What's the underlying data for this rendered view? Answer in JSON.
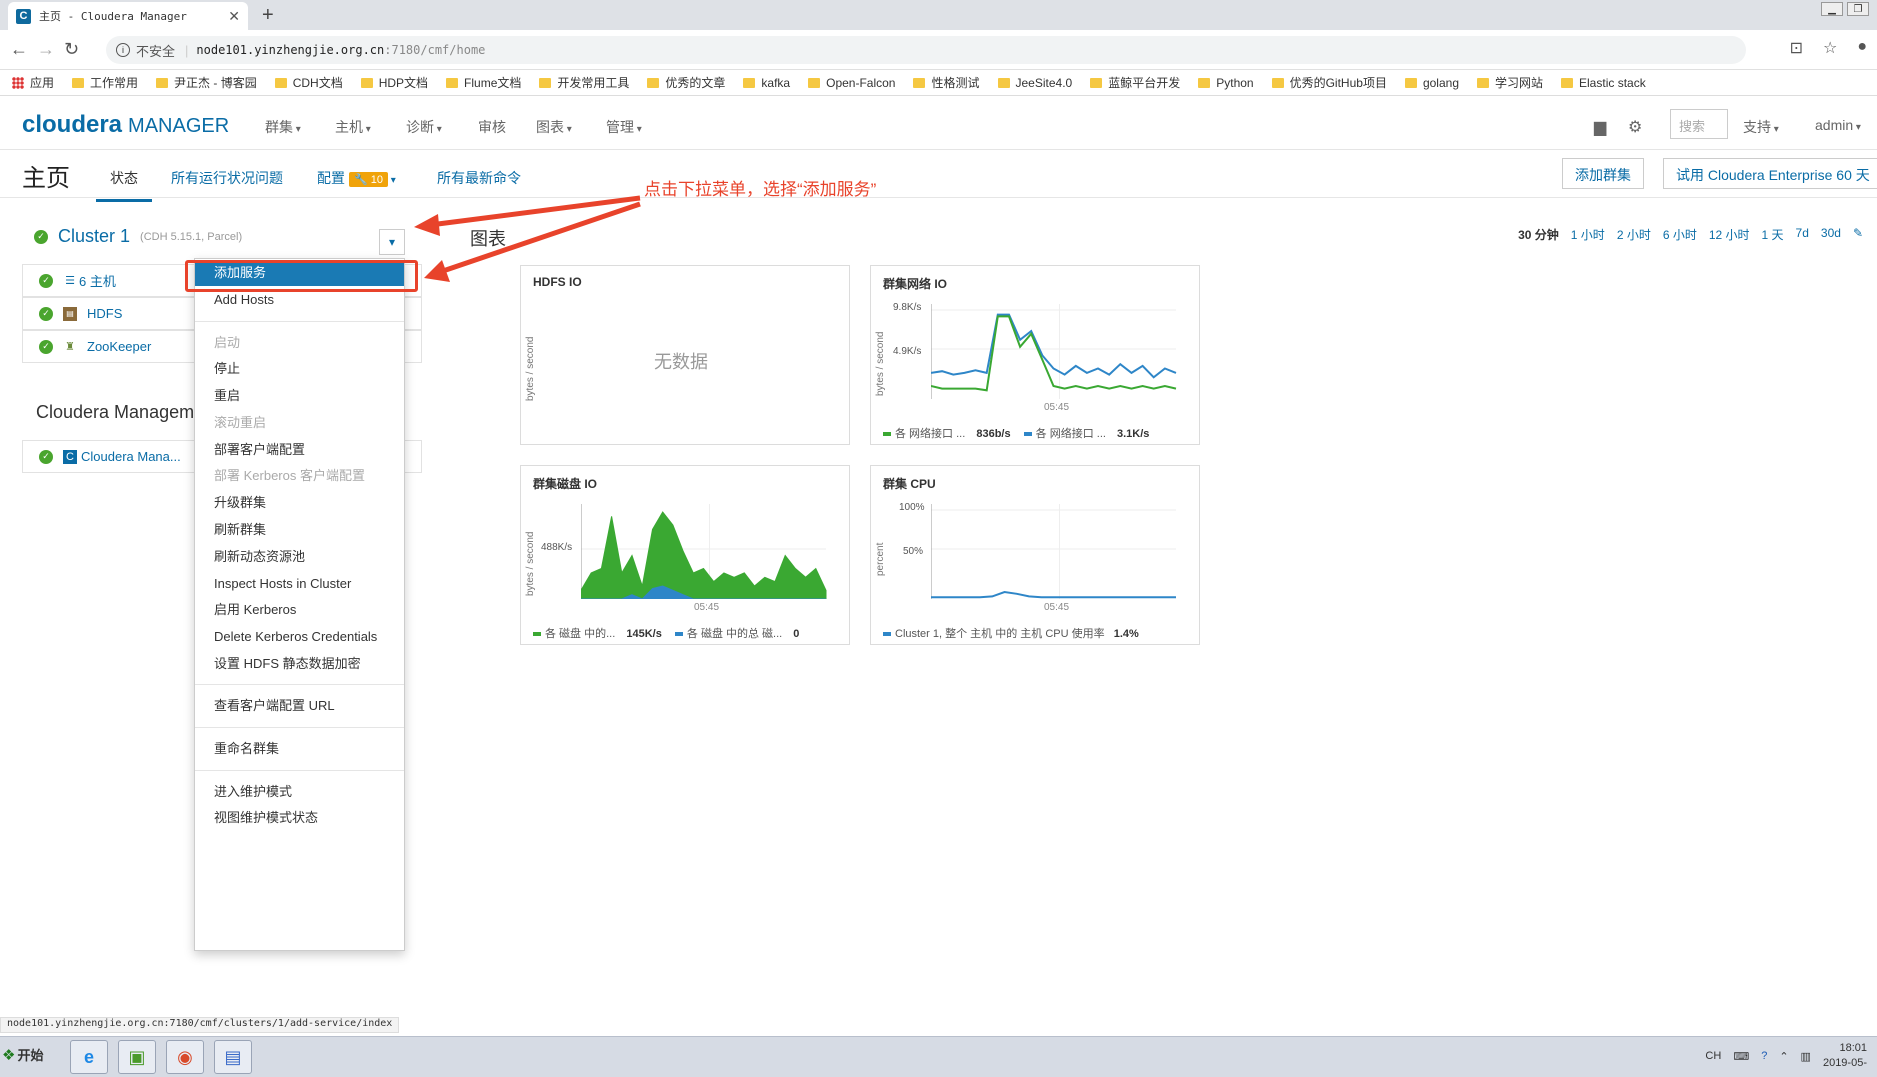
{
  "browser": {
    "tab_title": "主页 - Cloudera Manager",
    "new_tab": "+",
    "insecure_label": "不安全",
    "url_host": "node101.yinzhengjie.org.cn",
    "url_path": ":7180/cmf/home",
    "bookmarks": [
      "应用",
      "工作常用",
      "尹正杰 - 博客园",
      "CDH文档",
      "HDP文档",
      "Flume文档",
      "开发常用工具",
      "优秀的文章",
      "kafka",
      "Open-Falcon",
      "性格测试",
      "JeeSite4.0",
      "蓝鲸平台开发",
      "Python",
      "优秀的GitHub项目",
      "golang",
      "学习网站",
      "Elastic stack"
    ]
  },
  "cm_header": {
    "logo_main": "cloudera",
    "logo_sub": "MANAGER",
    "nav": [
      "群集",
      "主机",
      "诊断",
      "审核",
      "图表",
      "管理"
    ],
    "search_placeholder": "搜索",
    "support": "支持",
    "user": "admin"
  },
  "subheader": {
    "title": "主页",
    "tabs": [
      "状态",
      "所有运行状况问题",
      "配置",
      "所有最新命令"
    ],
    "config_badge": "10",
    "add_cluster": "添加群集",
    "try_enterprise": "试用 Cloudera Enterprise 60 天"
  },
  "cluster": {
    "name": "Cluster 1",
    "version": "(CDH 5.15.1, Parcel)",
    "services": [
      "6 主机",
      "HDFS",
      "ZooKeeper"
    ],
    "cms_title": "Cloudera Managem",
    "cms_service": "Cloudera Mana..."
  },
  "dropdown": {
    "items": [
      "添加服务",
      "Add Hosts",
      "启动",
      "停止",
      "重启",
      "滚动重启",
      "部署客户端配置",
      "部署 Kerberos 客户端配置",
      "升级群集",
      "刷新群集",
      "刷新动态资源池",
      "Inspect Hosts in Cluster",
      "启用 Kerberos",
      "Delete Kerberos Credentials",
      "设置 HDFS 静态数据加密",
      "查看客户端配置 URL",
      "重命名群集",
      "进入维护模式",
      "视图维护模式状态"
    ]
  },
  "annotation": "点击下拉菜单，选择“添加服务”",
  "charts_section": {
    "label": "图表",
    "time_ranges": [
      "30 分钟",
      "1 小时",
      "2 小时",
      "6 小时",
      "12 小时",
      "1 天",
      "7d",
      "30d"
    ]
  },
  "charts": {
    "hdfs": {
      "title": "HDFS IO",
      "ylabel": "bytes / second",
      "empty": "无数据"
    },
    "network": {
      "title": "群集网络 IO",
      "ylabel": "bytes / second",
      "y1": "9.8K/s",
      "y2": "4.9K/s",
      "xtick": "05:45",
      "legend1": "各 网络接口 ...",
      "legend1_val": "836b/s",
      "legend2": "各 网络接口 ...",
      "legend2_val": "3.1K/s",
      "series_green": [
        0.15,
        0.12,
        0.12,
        0.12,
        0.12,
        0.1,
        0.95,
        0.95,
        0.6,
        0.75,
        0.45,
        0.15,
        0.12,
        0.15,
        0.12,
        0.15,
        0.12,
        0.15,
        0.12,
        0.15,
        0.12,
        0.15,
        0.12
      ],
      "series_blue": [
        0.3,
        0.32,
        0.28,
        0.3,
        0.33,
        0.3,
        0.97,
        0.97,
        0.68,
        0.78,
        0.5,
        0.35,
        0.28,
        0.38,
        0.3,
        0.35,
        0.28,
        0.4,
        0.3,
        0.38,
        0.25,
        0.35,
        0.3
      ]
    },
    "disk": {
      "title": "群集磁盘 IO",
      "ylabel": "bytes / second",
      "y1": "488K/s",
      "xtick": "05:45",
      "legend1": "各 磁盘 中的...",
      "legend1_val": "145K/s",
      "legend2": "各 磁盘 中的总 磁...",
      "legend2_val": "0",
      "series_green": [
        0.1,
        0.3,
        0.35,
        0.95,
        0.3,
        0.5,
        0.15,
        0.8,
        1.0,
        0.85,
        0.55,
        0.3,
        0.35,
        0.2,
        0.3,
        0.25,
        0.3,
        0.15,
        0.25,
        0.2,
        0.5,
        0.35,
        0.25,
        0.35,
        0.1
      ],
      "series_blue": [
        0,
        0,
        0,
        0,
        0,
        0.05,
        0,
        0.12,
        0.15,
        0.1,
        0.05,
        0,
        0,
        0,
        0,
        0,
        0,
        0,
        0,
        0,
        0,
        0,
        0,
        0,
        0
      ]
    },
    "cpu": {
      "title": "群集 CPU",
      "ylabel": "percent",
      "y1": "100%",
      "y2": "50%",
      "xtick": "05:45",
      "legend1": "Cluster 1, 整个 主机 中的 主机 CPU 使用率",
      "legend1_val": "1.4%",
      "series_blue": [
        0.02,
        0.02,
        0.02,
        0.02,
        0.02,
        0.03,
        0.08,
        0.06,
        0.03,
        0.02,
        0.02,
        0.02,
        0.02,
        0.02,
        0.02,
        0.02,
        0.02,
        0.02,
        0.02,
        0.02,
        0.02
      ]
    }
  },
  "status_url": "node101.yinzhengjie.org.cn:7180/cmf/clusters/1/add-service/index",
  "taskbar": {
    "start": "开始",
    "lang": "CH",
    "time": "18:01",
    "date": "2019-05-"
  },
  "colors": {
    "accent": "#0a6ca6",
    "ok_green": "#4aa52e",
    "annotation_red": "#e8432b",
    "series_green": "#3aa832",
    "series_blue": "#2e86c8"
  }
}
